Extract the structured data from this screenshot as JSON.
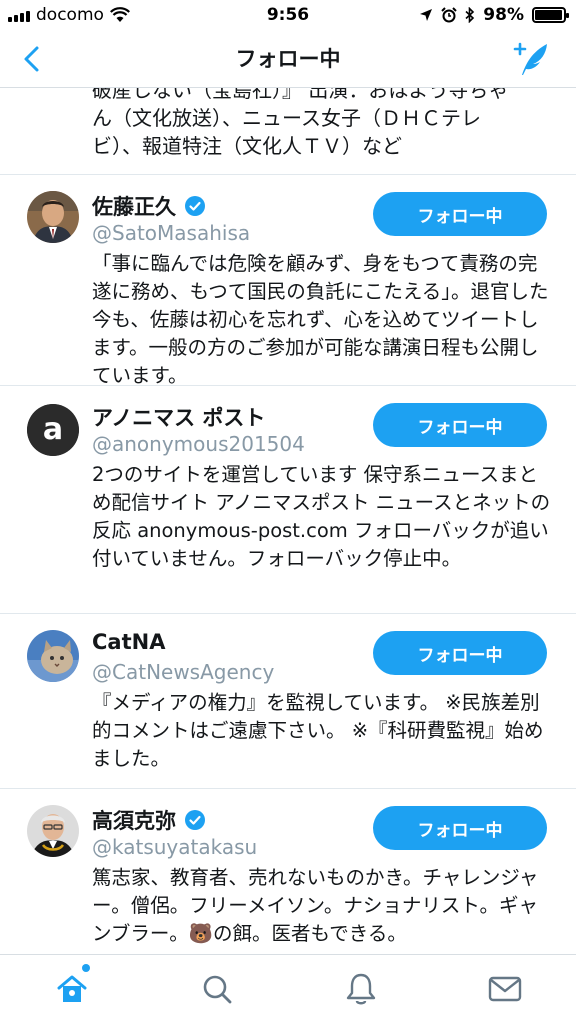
{
  "status_bar": {
    "carrier": "docomo",
    "time": "9:56",
    "battery": "98%",
    "battery_level": 0.98
  },
  "nav": {
    "title": "フォロー中",
    "back_icon": "chevron-left-icon",
    "compose_icon": "compose-tweet-icon"
  },
  "truncated_bio": {
    "line1": "破産しない（宝島社）』 出演：おはよう寺ちゃ",
    "line2": "ん（文化放送）、ニュース女子（ＤＨＣテレ",
    "line3": "ビ）、報道特注（文化人ＴＶ）など"
  },
  "users": [
    {
      "name": "佐藤正久",
      "handle": "@SatoMasahisa",
      "verified": true,
      "bio": "「事に臨んでは危険を顧みず、身をもつて責務の完遂に務め、もつて国民の負託にこたえる」。退官した今も、佐藤は初心を忘れず、心を込めてツイートします。一般の方のご参加が可能な講演日程も公開しています。",
      "button": "フォロー中"
    },
    {
      "name": "アノニマス ポスト",
      "handle": "@anonymous201504",
      "verified": false,
      "bio": "2つのサイトを運営しています 保守系ニュースまとめ配信サイト アノニマスポスト ニュースとネットの反応 anonymous-post.com フォローバックが追い付いていません。フォローバック停止中。",
      "button": "フォロー中"
    },
    {
      "name": "CatNA",
      "handle": "@CatNewsAgency",
      "verified": false,
      "bio": "『メディアの権力』を監視しています。 ※民族差別的コメントはご遠慮下さい。 ※『科研費監視』始めました。",
      "button": "フォロー中"
    },
    {
      "name": "高須克弥",
      "handle": "@katsuyatakasu",
      "verified": true,
      "bio": "篤志家、教育者、売れないものかき。チャレンジャー。僧侶。フリーメイソン。ナショナリスト。ギャンブラー。🐻の餌。医者もできる。",
      "button": "フォロー中"
    }
  ],
  "tabs": [
    {
      "icon": "home-icon",
      "active": true
    },
    {
      "icon": "search-icon",
      "active": false
    },
    {
      "icon": "bell-icon",
      "active": false
    },
    {
      "icon": "mail-icon",
      "active": false
    }
  ],
  "colors": {
    "accent": "#1da1f2",
    "secondary_text": "#8899a6",
    "divider": "#e1e8ed"
  }
}
